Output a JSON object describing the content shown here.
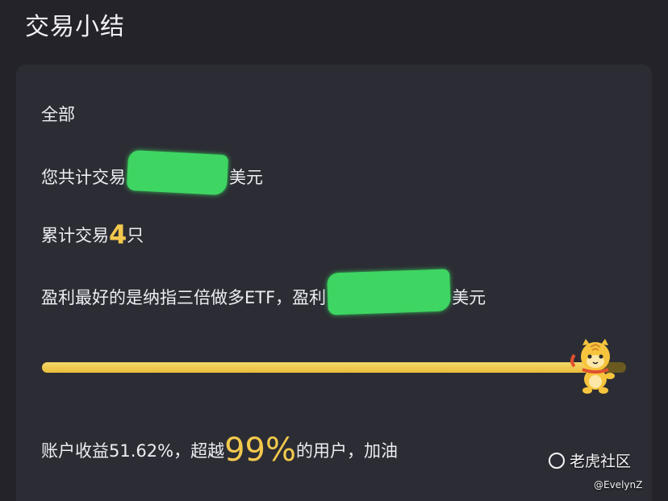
{
  "page": {
    "title": "交易小结"
  },
  "summary_card": {
    "scope_label": "全部",
    "total_prefix": "您共计交易",
    "total_suffix": "美元",
    "count_prefix": "累计交易",
    "count_value": "4",
    "count_suffix": "只",
    "best_text": "盈利最好的是纳指三倍做多ETF，盈利",
    "best_suffix": "美元",
    "progress_fraction": 0.95,
    "returns_prefix": "账户收益51.62%，超越",
    "returns_percent": "99%",
    "returns_suffix": "的用户，加油"
  },
  "watermark": {
    "community_name": "老虎社区",
    "author": "@EvelynZ"
  },
  "colors": {
    "background": "#232329",
    "card": "#2c2d34",
    "accent": "#f3c94d",
    "redaction": "#3ed562"
  },
  "icons": {
    "mascot": "tiger-mascot-icon",
    "logo": "tiger-community-logo-icon"
  }
}
